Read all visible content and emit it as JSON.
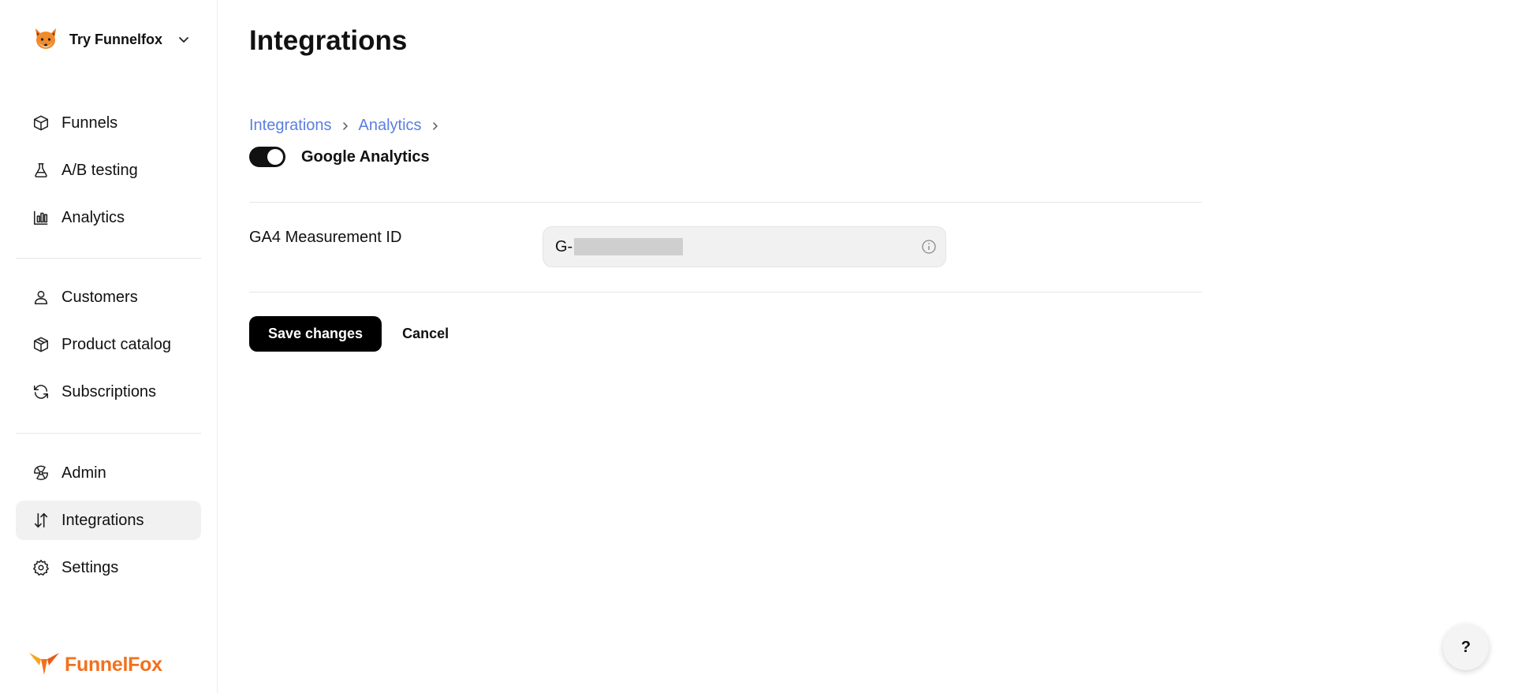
{
  "workspace": {
    "name": "Try Funnelfox",
    "avatar_icon": "fox-face-icon"
  },
  "sidebar": {
    "groups": [
      [
        {
          "label": "Funnels",
          "icon": "cube-icon"
        },
        {
          "label": "A/B testing",
          "icon": "flask-icon"
        },
        {
          "label": "Analytics",
          "icon": "bar-chart-icon"
        }
      ],
      [
        {
          "label": "Customers",
          "icon": "user-icon"
        },
        {
          "label": "Product catalog",
          "icon": "package-icon"
        },
        {
          "label": "Subscriptions",
          "icon": "refresh-icon"
        }
      ],
      [
        {
          "label": "Admin",
          "icon": "radiation-icon"
        },
        {
          "label": "Integrations",
          "icon": "arrows-up-down-icon",
          "active": true
        },
        {
          "label": "Settings",
          "icon": "gear-icon"
        }
      ]
    ],
    "brand": {
      "name": "FunnelFox",
      "color": "#f2711c"
    }
  },
  "main": {
    "title": "Integrations",
    "breadcrumb": [
      "Integrations",
      "Analytics"
    ],
    "integration": {
      "name": "Google Analytics",
      "enabled": true
    },
    "field": {
      "label": "GA4 Measurement ID",
      "value_prefix": "G-"
    },
    "actions": {
      "save": "Save changes",
      "cancel": "Cancel"
    }
  },
  "help": {
    "label": "?"
  },
  "colors": {
    "link": "#5b7fe0",
    "primary": "#000000",
    "active_bg": "#f1f1f1"
  }
}
